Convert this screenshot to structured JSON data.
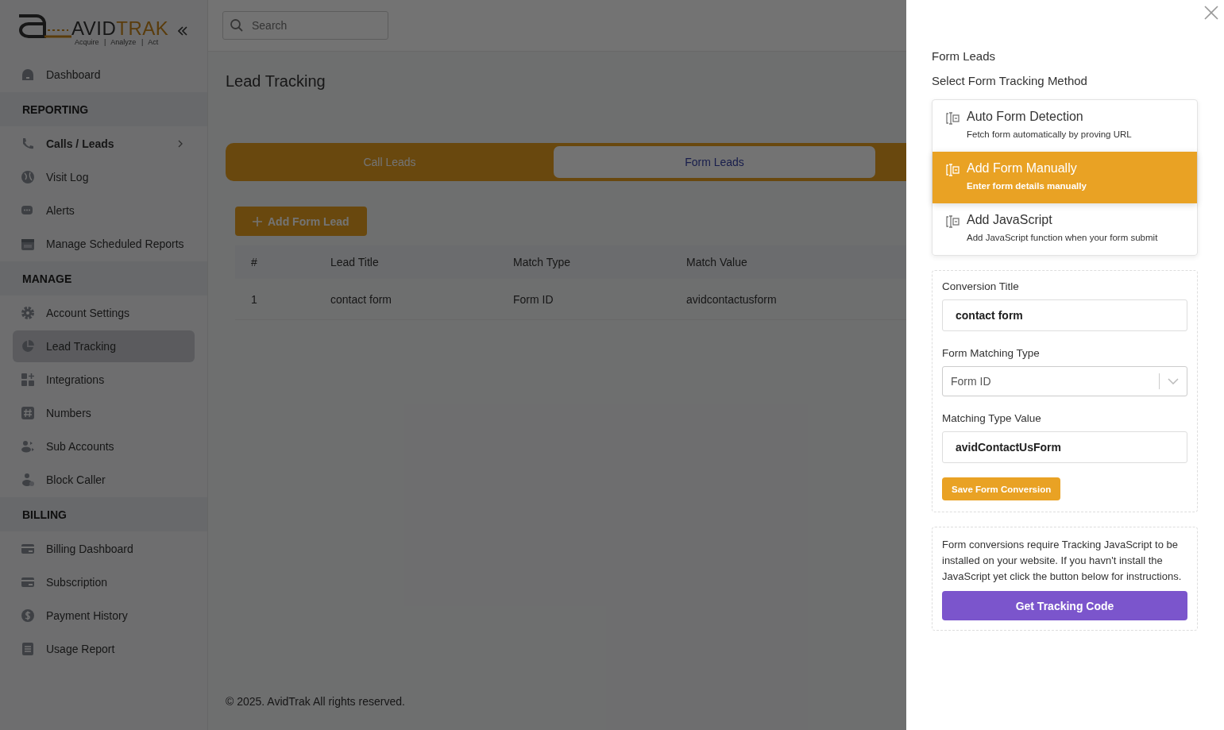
{
  "logo": {
    "word_dark": "AVID",
    "word_accent": "TRAK",
    "tagline": "Acquire | Analyze | Act"
  },
  "sidebar": {
    "items": [
      {
        "kind": "link",
        "label": "Dashboard",
        "selected": false
      },
      {
        "kind": "section",
        "label": "REPORTING"
      },
      {
        "kind": "group",
        "label": "Calls / Leads",
        "expanded": false
      },
      {
        "kind": "link",
        "label": "Visit Log",
        "selected": false
      },
      {
        "kind": "link",
        "label": "Alerts",
        "selected": false
      },
      {
        "kind": "link",
        "label": "Manage Scheduled Reports",
        "selected": false
      },
      {
        "kind": "section",
        "label": "MANAGE"
      },
      {
        "kind": "link",
        "label": "Account Settings",
        "selected": false
      },
      {
        "kind": "link",
        "label": "Lead Tracking",
        "selected": true
      },
      {
        "kind": "link",
        "label": "Integrations",
        "selected": false
      },
      {
        "kind": "link",
        "label": "Numbers",
        "selected": false
      },
      {
        "kind": "link",
        "label": "Sub Accounts",
        "selected": false
      },
      {
        "kind": "link",
        "label": "Block Caller",
        "selected": false
      },
      {
        "kind": "section",
        "label": "BILLING"
      },
      {
        "kind": "link",
        "label": "Billing Dashboard",
        "selected": false
      },
      {
        "kind": "link",
        "label": "Subscription",
        "selected": false
      },
      {
        "kind": "link",
        "label": "Payment History",
        "selected": false
      },
      {
        "kind": "link",
        "label": "Usage Report",
        "selected": false
      }
    ]
  },
  "search": {
    "placeholder": "Search"
  },
  "page": {
    "title": "Lead Tracking"
  },
  "lead_tabs": [
    {
      "label": "Call Leads",
      "selected": false
    },
    {
      "label": "Form Leads",
      "selected": true
    }
  ],
  "add_button": {
    "label": "Add Form Lead"
  },
  "table": {
    "columns": [
      "#",
      "Lead Title",
      "Match Type",
      "Match Value"
    ],
    "rows": [
      [
        "1",
        "contact form",
        "Form ID",
        "avidcontactusform"
      ]
    ]
  },
  "footer": "© 2025. AvidTrak All rights reserved.",
  "drawer": {
    "title": "Form Leads",
    "subtitle": "Select Form Tracking Method",
    "methods": [
      {
        "title": "Auto Form Detection",
        "description": "Fetch form automatically by proving URL",
        "selected": false
      },
      {
        "title": "Add Form Manually",
        "description": "Enter form details manually",
        "selected": true
      },
      {
        "title": "Add JavaScript",
        "description": "Add JavaScript function when your form submit",
        "selected": false
      }
    ],
    "fields": [
      {
        "kind": "text",
        "label": "Conversion Title",
        "value": "contact form"
      },
      {
        "kind": "select",
        "label": "Form Matching Type",
        "value": "Form ID"
      },
      {
        "kind": "text",
        "label": "Matching Type Value",
        "value": "avidContactUsForm"
      }
    ],
    "save_button": "Save Form Conversion",
    "notice": "Form conversions require Tracking JavaScript to be installed on your website. If you havn't install the JavaScript yet click the button below for instructions.",
    "tracking_button": "Get Tracking Code"
  }
}
